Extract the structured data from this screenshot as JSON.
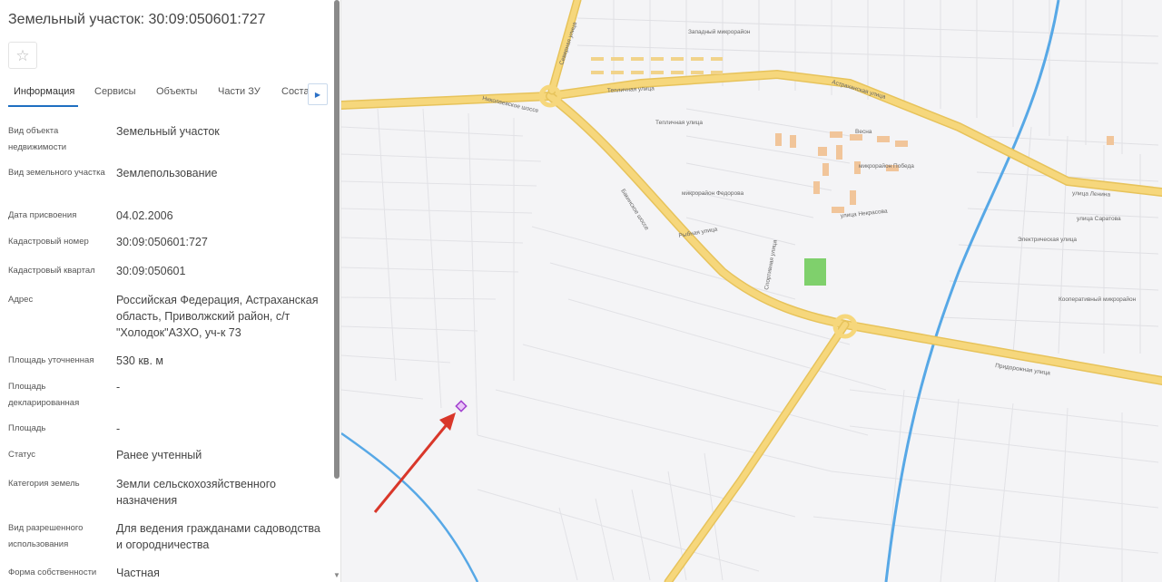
{
  "panel": {
    "title": "Земельный участок: 30:09:050601:727",
    "star_icon": "star-icon",
    "tabs": [
      {
        "label": "Информация",
        "active": true
      },
      {
        "label": "Сервисы",
        "active": false
      },
      {
        "label": "Объекты",
        "active": false
      },
      {
        "label": "Части ЗУ",
        "active": false
      },
      {
        "label": "Состав",
        "active": false
      }
    ],
    "tab_next_icon": "chevron-right-icon",
    "rows": [
      {
        "label": "Вид объекта недвижимости",
        "value": "Земельный участок"
      },
      {
        "label": "Вид земельного участка",
        "value": "Землепользование"
      },
      {
        "label": "Дата присвоения",
        "value": "04.02.2006"
      },
      {
        "label": "Кадастровый номер",
        "value": "30:09:050601:727"
      },
      {
        "label": "Кадастровый квартал",
        "value": "30:09:050601"
      },
      {
        "label": "Адрес",
        "value": "Российская Федерация, Астраханская область, Приволжский район, с/т \"Холодок\"АЗХО, уч-к 73"
      },
      {
        "label": "Площадь уточненная",
        "value": "530 кв. м"
      },
      {
        "label": "Площадь декларированная",
        "value": "-"
      },
      {
        "label": "Площадь",
        "value": "-"
      },
      {
        "label": "Статус",
        "value": "Ранее учтенный"
      },
      {
        "label": "Категория земель",
        "value": "Земли сельскохозяйственного назначения"
      },
      {
        "label": "Вид разрешенного использования",
        "value": "Для ведения гражданами садоводства и огородничества"
      },
      {
        "label": "Форма собственности",
        "value": "Частная"
      }
    ]
  },
  "map": {
    "labels": {
      "zapadny": "Западный микрорайон",
      "severnaya": "Северная улица",
      "teplichnaya": "Тепличная улица",
      "teplichnaya2": "Тепличная улица",
      "astrakhanskaya": "Астраханская улица",
      "shosse": "Николаевское шоссе",
      "bakinskaya": "Бакинское шоссе",
      "pobeda": "микрорайон Победа",
      "fedorova": "микрорайон Федорова",
      "lenina": "улица Ленина",
      "nekrasova": "улица Некрасова",
      "saratova": "улица Саратова",
      "elektricheskaya": "Электрическая улица",
      "sportivnaya": "Спортивная улица",
      "kooperativny": "Кооперативный микрорайон",
      "pridorozhnaya": "Придорожная улица",
      "vesna": "Весна",
      "rybnaya": "Рыбная улица"
    },
    "colors": {
      "road": "#f6d77c",
      "road_edge": "#e7c35b",
      "water": "#57a8e6",
      "park": "#7fd06c",
      "building": "#f1c59a",
      "marker": "#a13fcf",
      "arrow": "#d9372a"
    }
  }
}
